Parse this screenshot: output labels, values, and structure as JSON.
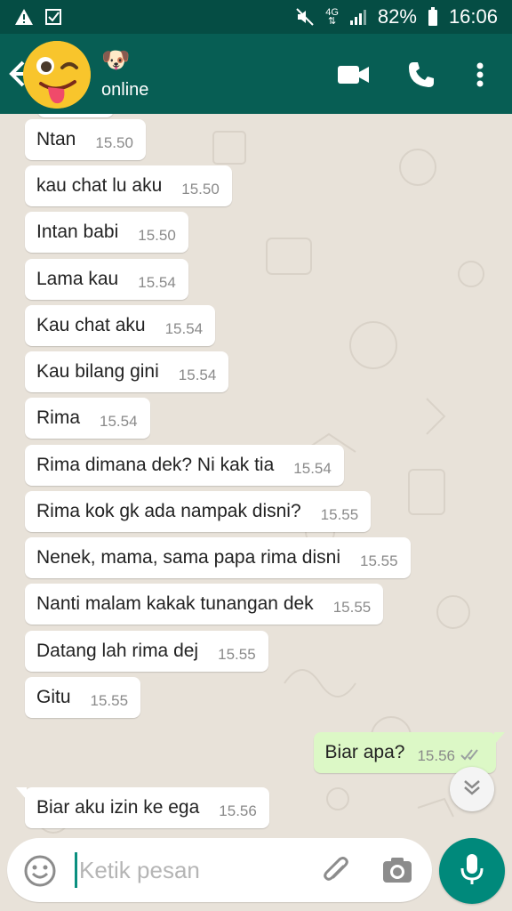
{
  "status_bar": {
    "left_icons": [
      "warning-icon",
      "checkbox-icon"
    ],
    "right_icons": [
      "mute-icon",
      "network-4g-icon",
      "signal-icon",
      "battery-icon"
    ],
    "network_label": "4G",
    "battery": "82%",
    "time": "16:06"
  },
  "header": {
    "contact_name": "🐶",
    "status": "online",
    "avatar_icon": "winking-tongue-face-icon",
    "colors": {
      "header": "#075e54",
      "status_bar": "#054d44"
    }
  },
  "messages": [
    {
      "text": "Ntan",
      "time": "15.50",
      "direction": "in"
    },
    {
      "text": "kau chat lu aku",
      "time": "15.50",
      "direction": "in"
    },
    {
      "text": "Intan babi",
      "time": "15.50",
      "direction": "in"
    },
    {
      "text": "Lama kau",
      "time": "15.54",
      "direction": "in"
    },
    {
      "text": "Kau chat aku",
      "time": "15.54",
      "direction": "in"
    },
    {
      "text": "Kau bilang gini",
      "time": "15.54",
      "direction": "in"
    },
    {
      "text": "Rima",
      "time": "15.54",
      "direction": "in"
    },
    {
      "text": "Rima dimana dek? Ni kak tia",
      "time": "15.54",
      "direction": "in"
    },
    {
      "text": "Rima kok gk ada nampak disni?",
      "time": "15.55",
      "direction": "in"
    },
    {
      "text": "Nenek, mama, sama papa rima disni",
      "time": "15.55",
      "direction": "in"
    },
    {
      "text": "Nanti malam kakak tunangan dek",
      "time": "15.55",
      "direction": "in"
    },
    {
      "text": "Datang lah rima dej",
      "time": "15.55",
      "direction": "in"
    },
    {
      "text": "Gitu",
      "time": "15.55",
      "direction": "in"
    },
    {
      "text": "Biar apa?",
      "time": "15.56",
      "direction": "out",
      "ticks": "double-check-icon"
    },
    {
      "text": "Biar aku izin ke ega",
      "time": "15.56",
      "direction": "in"
    }
  ],
  "input": {
    "placeholder": "Ketik pesan",
    "value": ""
  },
  "colors": {
    "incoming_bubble": "#ffffff",
    "outgoing_bubble": "#dcf8c6",
    "mic_button": "#00897b",
    "chat_background": "#e8e2d9"
  }
}
